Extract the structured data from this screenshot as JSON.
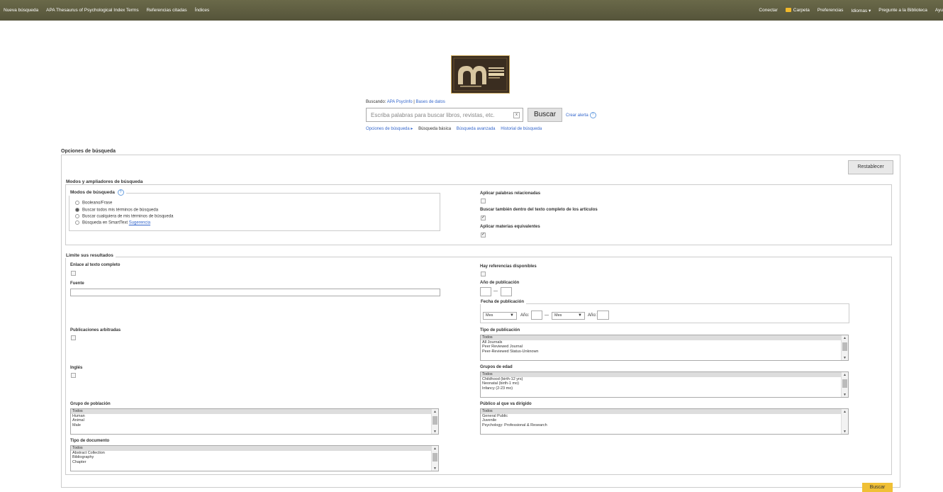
{
  "topnav": {
    "left": [
      "Nueva búsqueda",
      "APA Thesaurus of Psychological Index Terms",
      "Referencias citadas",
      "Índices"
    ],
    "right": {
      "connect": "Conectar",
      "folder": "Carpeta",
      "prefs": "Preferencias",
      "languages": "Idiomas ▾",
      "ask": "Pregunte a la Biblioteca",
      "help": "Ayu"
    }
  },
  "search": {
    "searching_label": "Buscando:",
    "db": "APA PsycInfo",
    "db_link": "Bases de datos",
    "placeholder": "Escriba palabras para buscar libros, revistas, etc.",
    "clear": "x",
    "button": "Buscar",
    "alert": "Crear alerta",
    "sublinks": {
      "options": "Opciones de búsqueda ▸",
      "basic": "Búsqueda básica",
      "advanced": "Búsqueda avanzada",
      "history": "Historial de búsqueda"
    }
  },
  "options": {
    "title": "Opciones de búsqueda",
    "reset": "Restablecer",
    "modes_section": "Modos y ampliadores de búsqueda",
    "modes_label": "Modos de búsqueda",
    "modes": [
      "Booleano/Frase",
      "Buscar todos mis términos de búsqueda",
      "Buscar cualquiera de mis términos de búsqueda",
      "Búsqueda en SmartText"
    ],
    "suggestion": "Sugerencia",
    "related": "Aplicar palabras relacionadas",
    "fulltext_search": "Buscar también dentro del texto completo de los artículos",
    "equiv": "Aplicar materias equivalentes"
  },
  "limits": {
    "title": "Limite sus resultados",
    "fulltext_link": "Enlace al texto completo",
    "refs_available": "Hay referencias disponibles",
    "source": "Fuente",
    "pub_year": "Año de publicación",
    "pub_date": "Fecha de publicación",
    "month": "Mes",
    "year": "Año:",
    "dash": "—",
    "peer": "Publicaciones arbitradas",
    "pub_type": "Tipo de publicación",
    "pub_type_opts": [
      "Todos",
      "All Journals",
      "Peer Reviewed Journal",
      "Peer-Reviewed Status-Unknown"
    ],
    "english": "Inglés",
    "age_groups": "Grupos de edad",
    "age_opts": [
      "Todos",
      "Childhood (birth-12 yrs)",
      "Neonatal (birth-1 mo)",
      "Infancy (2-23 mo)"
    ],
    "population": "Grupo de población",
    "population_opts": [
      "Todos",
      "Human",
      "Animal",
      "Male"
    ],
    "audience": "Público al que va dirigido",
    "audience_opts": [
      "Todos",
      "General Public",
      "Juvenile",
      "Psychology: Professional & Research"
    ],
    "doc_type": "Tipo de documento",
    "doc_opts": [
      "Todos",
      "Abstract Collection",
      "Bibliography",
      "Chapter"
    ]
  },
  "bottom_button": "Buscar"
}
